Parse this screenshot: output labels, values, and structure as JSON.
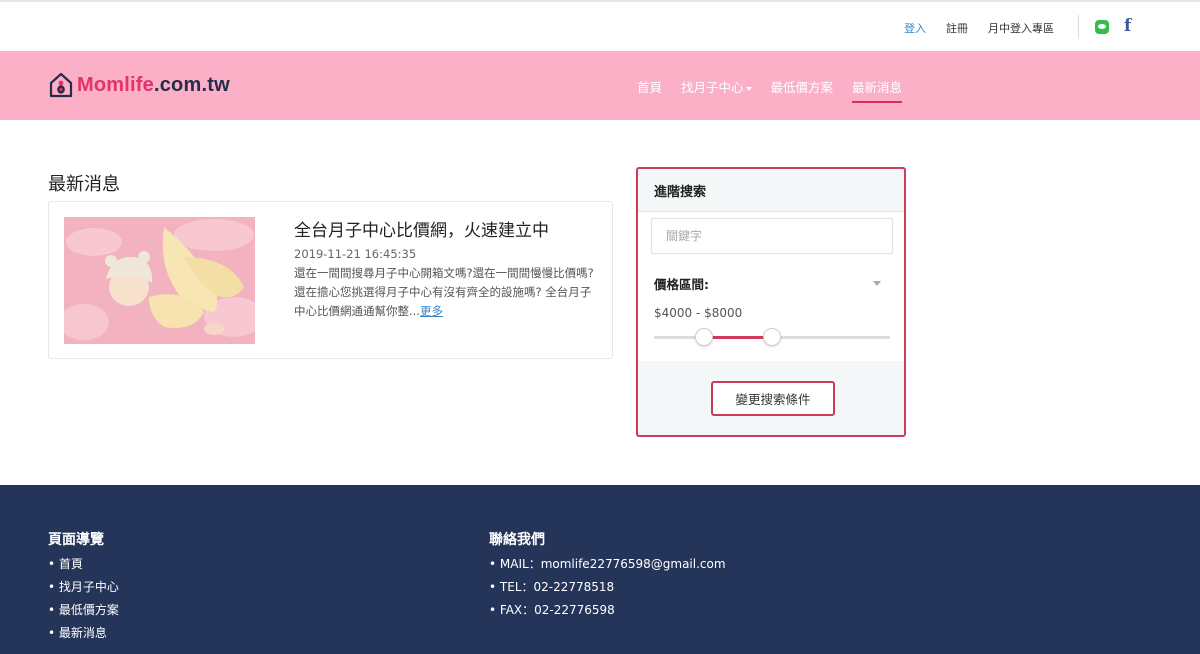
{
  "topbar": {
    "links": [
      "登入",
      "註冊",
      "月中登入專區"
    ]
  },
  "header": {
    "logo": {
      "brand_colored": "Momlife",
      "brand_rest": ".com.tw"
    },
    "nav": [
      {
        "label": "首頁",
        "dropdown": false,
        "active": false
      },
      {
        "label": "找月子中心",
        "dropdown": true,
        "active": false
      },
      {
        "label": "最低價方案",
        "dropdown": false,
        "active": false
      },
      {
        "label": "最新消息",
        "dropdown": false,
        "active": true
      }
    ]
  },
  "main": {
    "section_title": "最新消息",
    "news": [
      {
        "title": "全台月子中心比價網，火速建立中",
        "date": "2019-11-21  16:45:35",
        "excerpt": "還在一間間搜尋月子中心開箱文嗎?還在一間間慢慢比價嗎?還在擔心您挑選得月子中心有沒有齊全的設施嗎? 全台月子中心比價網通通幫你整...",
        "more_label": "更多"
      }
    ]
  },
  "search_panel": {
    "title": "進階搜索",
    "keyword_placeholder": "關鍵字",
    "price_label": "價格區間:",
    "price_range_text": "$4000  -  $8000",
    "slider": {
      "low_fraction": 0.21,
      "high_fraction": 0.5
    },
    "submit_label": "變更搜索條件"
  },
  "footer": {
    "nav_title": "頁面導覽",
    "nav_items": [
      "首頁",
      "找月子中心",
      "最低價方案",
      "最新消息"
    ],
    "contact_title": "聯絡我們",
    "contact_items": [
      "MAIL：momlife22776598@gmail.com",
      "TEL：02-22778518",
      "FAX：02-22776598"
    ]
  },
  "colors": {
    "header_bg": "#fbb0c8",
    "accent": "#d23a5c",
    "footer_bg": "#253559",
    "link_blue": "#3a87c8"
  }
}
